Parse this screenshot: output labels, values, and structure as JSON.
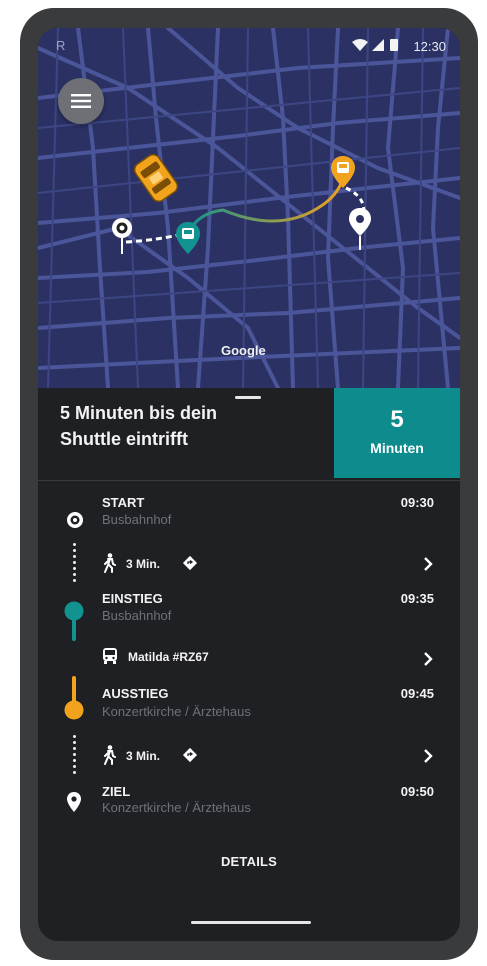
{
  "status_bar": {
    "carrier": "R",
    "time": "12:30"
  },
  "map": {
    "attribution": "Google",
    "icons": [
      "menu-icon",
      "taxi-icon",
      "start-pin-icon",
      "shuttle-pickup-icon",
      "shuttle-dropoff-icon",
      "destination-pin-icon"
    ],
    "colors": {
      "background": "#2b3263",
      "roads": "#4b5599",
      "route_teal": "#12938f",
      "route_orange": "#f2a31d"
    }
  },
  "arrival": {
    "text": "5 Minuten bis dein Shuttle eintrifft",
    "minutes_value": "5",
    "minutes_label": "Minuten"
  },
  "timeline": {
    "start": {
      "title": "START",
      "subtitle": "Busbahnhof",
      "time": "09:30"
    },
    "walk_1": {
      "label": "3 Min."
    },
    "boarding": {
      "title": "EINSTIEG",
      "subtitle": "Busbahnhof",
      "time": "09:35"
    },
    "shuttle": {
      "label": "Matilda #RZ67"
    },
    "exit": {
      "title": "AUSSTIEG",
      "subtitle": "Konzertkirche / Ärztehaus",
      "time": "09:45"
    },
    "walk_2": {
      "label": "3 Min."
    },
    "destination": {
      "title": "ZIEL",
      "subtitle": "Konzertkirche / Ärztehaus",
      "time": "09:50"
    }
  },
  "details_label": "DETAILS",
  "colors": {
    "accent_teal": "#0e8b8d",
    "accent_orange": "#f2a31d",
    "sheet_background": "#1f2023"
  }
}
